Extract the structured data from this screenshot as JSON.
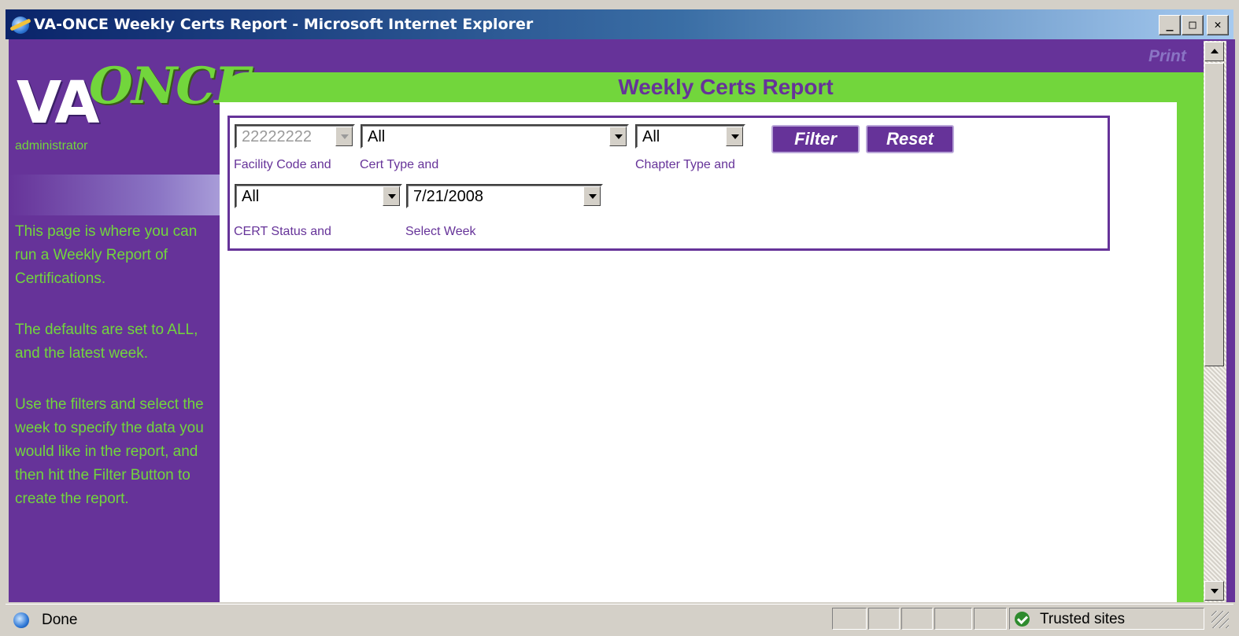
{
  "window": {
    "title": "VA-ONCE Weekly Certs Report - Microsoft Internet Explorer",
    "min_label": "_",
    "max_label": "□",
    "close_label": "✕"
  },
  "sidebar": {
    "logo_va": "VA",
    "logo_once": "ONCE",
    "user": "administrator",
    "help": [
      "This page is where you can run a Weekly Report of Certifications.",
      "The defaults are set to ALL, and the latest week.",
      "Use the filters and select the week to specify the data you would like in the report, and then hit the Filter Button to create the report."
    ]
  },
  "header": {
    "title": "Weekly Certs Report",
    "print_label": "Print"
  },
  "filters": {
    "facility_code": {
      "value": "22222222",
      "label": "Facility Code and",
      "disabled": true
    },
    "cert_type": {
      "value": "All",
      "label": "Cert Type and"
    },
    "chapter_type": {
      "value": "All",
      "label": "Chapter Type and"
    },
    "cert_status": {
      "value": "All",
      "label": "CERT Status and"
    },
    "select_week": {
      "value": "7/21/2008",
      "label": "Select Week"
    },
    "filter_button": "Filter",
    "reset_button": "Reset"
  },
  "statusbar": {
    "text": "Done",
    "zone": "Trusted sites"
  },
  "colors": {
    "purple": "#663399",
    "green": "#72d63c",
    "titlebar": "#0a246a"
  }
}
